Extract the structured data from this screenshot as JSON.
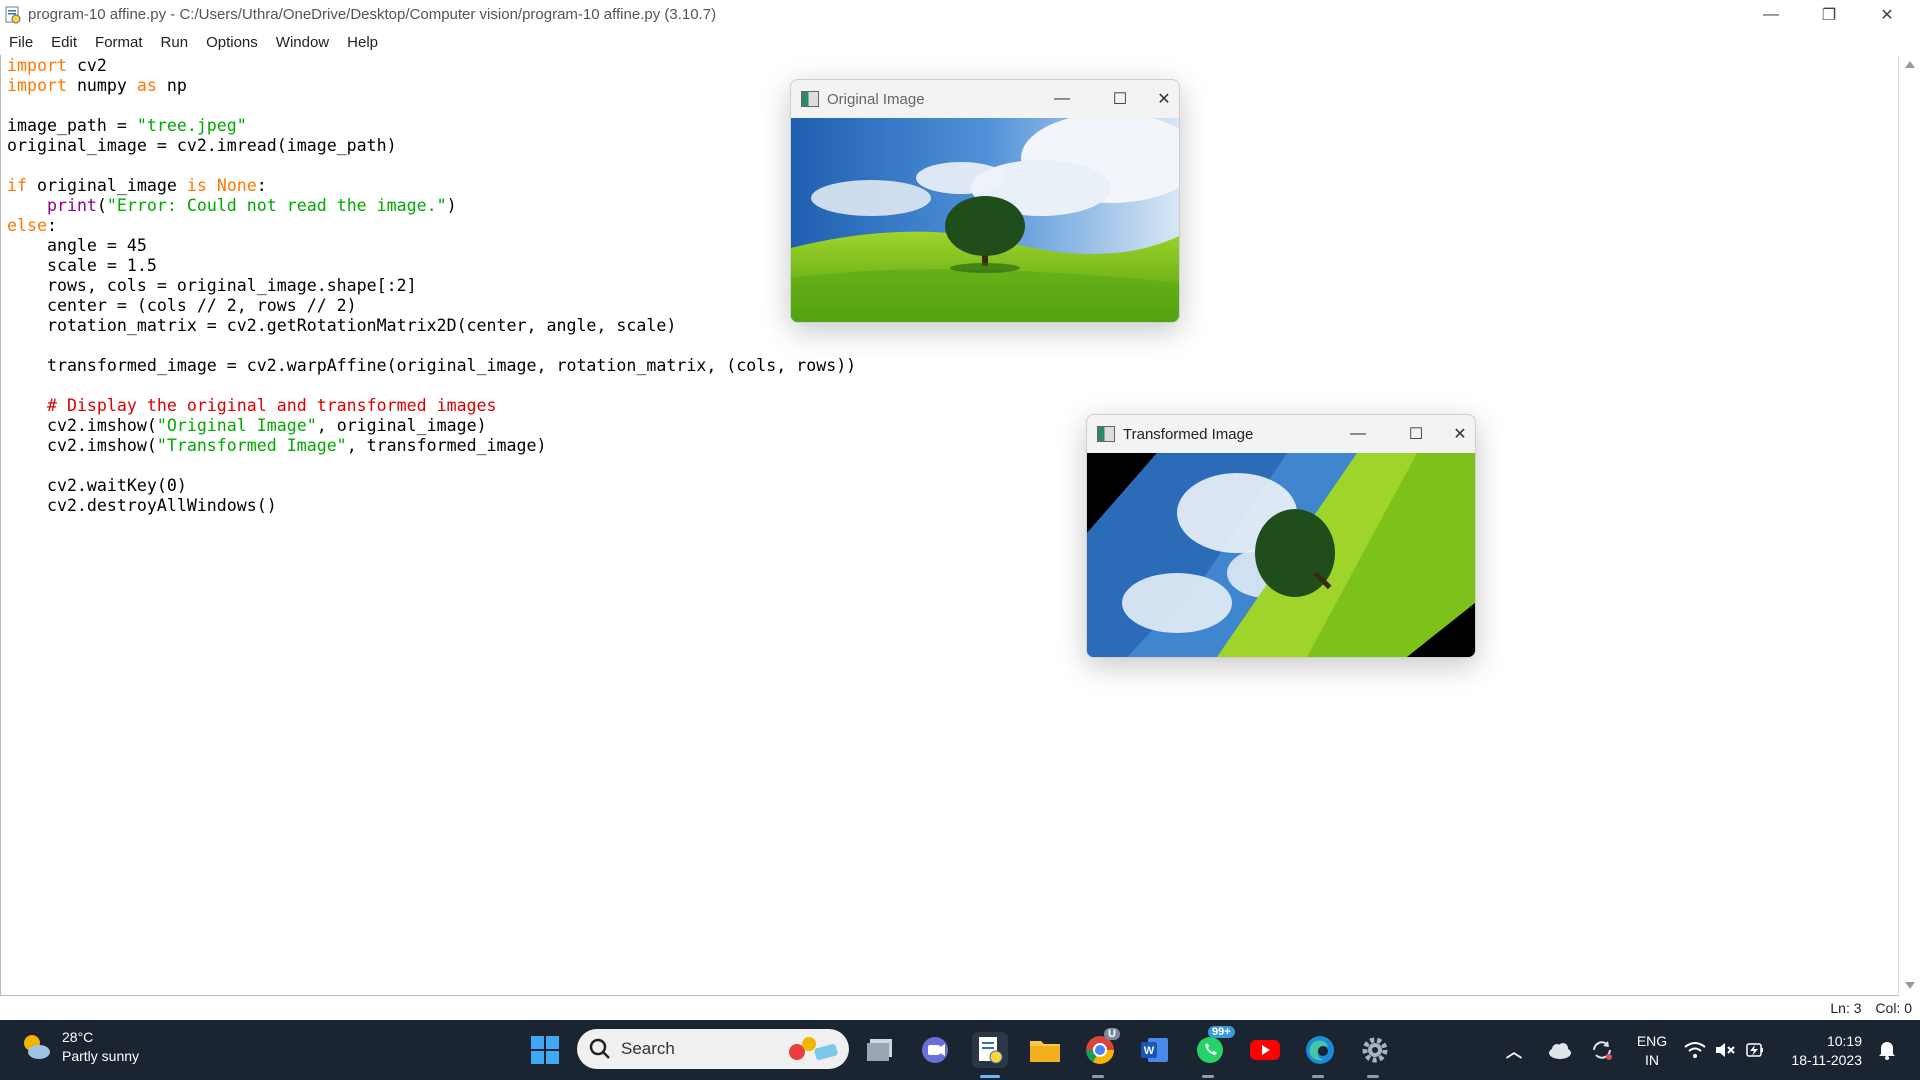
{
  "window": {
    "title": "program-10 affine.py - C:/Users/Uthra/OneDrive/Desktop/Computer vision/program-10 affine.py (3.10.7)"
  },
  "menu": [
    "File",
    "Edit",
    "Format",
    "Run",
    "Options",
    "Window",
    "Help"
  ],
  "code_lines": [
    [
      {
        "t": "kw",
        "v": "import"
      },
      {
        "t": "",
        "v": " cv2"
      }
    ],
    [
      {
        "t": "kw",
        "v": "import"
      },
      {
        "t": "",
        "v": " numpy "
      },
      {
        "t": "kw",
        "v": "as"
      },
      {
        "t": "",
        "v": " np"
      }
    ],
    [],
    [
      {
        "t": "",
        "v": "image_path = "
      },
      {
        "t": "str",
        "v": "\"tree.jpeg\""
      }
    ],
    [
      {
        "t": "",
        "v": "original_image = cv2.imread(image_path)"
      }
    ],
    [],
    [
      {
        "t": "kw",
        "v": "if"
      },
      {
        "t": "",
        "v": " original_image "
      },
      {
        "t": "kw",
        "v": "is"
      },
      {
        "t": "",
        "v": " "
      },
      {
        "t": "kw",
        "v": "None"
      },
      {
        "t": "",
        "v": ":"
      }
    ],
    [
      {
        "t": "",
        "v": "    "
      },
      {
        "t": "bi",
        "v": "print"
      },
      {
        "t": "",
        "v": "("
      },
      {
        "t": "str",
        "v": "\"Error: Could not read the image.\""
      },
      {
        "t": "",
        "v": ")"
      }
    ],
    [
      {
        "t": "kw",
        "v": "else"
      },
      {
        "t": "",
        "v": ":"
      }
    ],
    [
      {
        "t": "",
        "v": "    angle = 45"
      }
    ],
    [
      {
        "t": "",
        "v": "    scale = 1.5"
      }
    ],
    [
      {
        "t": "",
        "v": "    rows, cols = original_image.shape[:2]"
      }
    ],
    [
      {
        "t": "",
        "v": "    center = (cols // 2, rows // 2)"
      }
    ],
    [
      {
        "t": "",
        "v": "    rotation_matrix = cv2.getRotationMatrix2D(center, angle, scale)"
      }
    ],
    [],
    [
      {
        "t": "",
        "v": "    transformed_image = cv2.warpAffine(original_image, rotation_matrix, (cols, rows))"
      }
    ],
    [],
    [
      {
        "t": "",
        "v": "    "
      },
      {
        "t": "cm",
        "v": "# Display the original and transformed images"
      }
    ],
    [
      {
        "t": "",
        "v": "    cv2.imshow("
      },
      {
        "t": "str",
        "v": "\"Original Image\""
      },
      {
        "t": "",
        "v": ", original_image)"
      }
    ],
    [
      {
        "t": "",
        "v": "    cv2.imshow("
      },
      {
        "t": "str",
        "v": "\"Transformed Image\""
      },
      {
        "t": "",
        "v": ", transformed_image)"
      }
    ],
    [],
    [
      {
        "t": "",
        "v": "    cv2.waitKey(0)"
      }
    ],
    [
      {
        "t": "",
        "v": "    cv2.destroyAllWindows()"
      }
    ]
  ],
  "status": {
    "line": "Ln: 3",
    "col": "Col: 0"
  },
  "cv_windows": {
    "original": {
      "title": "Original Image"
    },
    "transformed": {
      "title": "Transformed Image"
    }
  },
  "taskbar": {
    "weather_temp": "28°C",
    "weather_desc": "Partly sunny",
    "search_label": "Search",
    "whatsapp_badge": "99+",
    "chrome_badge": "U",
    "lang_line1": "ENG",
    "lang_line2": "IN",
    "time": "10:19",
    "date": "18-11-2023"
  },
  "colors": {
    "keyword": "#ff7700",
    "string": "#00aa00",
    "builtin": "#900090",
    "comment": "#dd0000",
    "taskbar_bg": "#1b2532"
  }
}
